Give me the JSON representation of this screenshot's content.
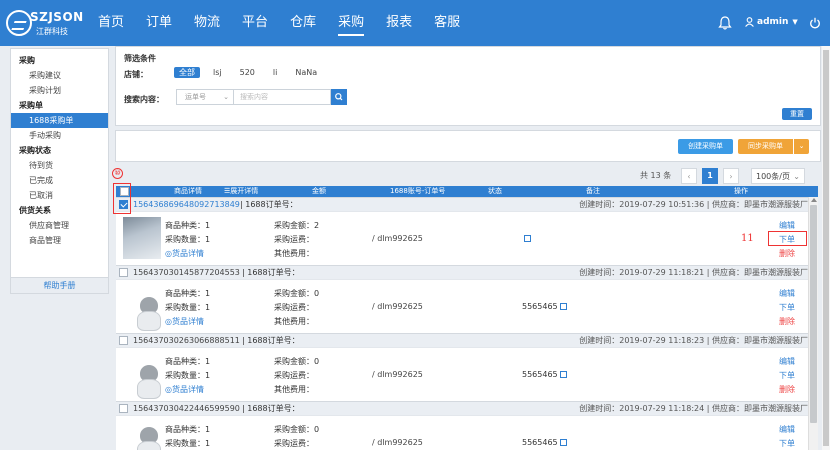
{
  "logo": {
    "name": "SZJSON",
    "sub": "江群科技"
  },
  "nav": [
    "首页",
    "订单",
    "物流",
    "平台",
    "仓库",
    "采购",
    "报表",
    "客服"
  ],
  "nav_active": 5,
  "user": {
    "name": "admin",
    "caret": "▼"
  },
  "sidebar": {
    "groups": [
      {
        "title": "采购",
        "items": [
          "采购建议",
          "采购计划"
        ]
      },
      {
        "title": "采购单",
        "items": [
          "1688采购单",
          "手动采购"
        ]
      },
      {
        "title": "采购状态",
        "items": [
          "待到货",
          "已完成",
          "已取消"
        ]
      },
      {
        "title": "供货关系",
        "items": [
          "供应商管理",
          "商品管理"
        ]
      }
    ],
    "active": "1688采购单",
    "help": "帮助手册"
  },
  "filter": {
    "title": "筛选条件",
    "shop_label": "店铺：",
    "shop_options": [
      "全部",
      "lsj",
      "520",
      "li",
      "NaNa"
    ],
    "search_label": "搜索内容：",
    "select_value": "运单号",
    "input_placeholder": "搜索内容",
    "reset": "重置"
  },
  "toolbar": {
    "create": "创建采购单",
    "sync": "同步采购单"
  },
  "pager": {
    "total": "共 13 条",
    "prev": "‹",
    "current": "1",
    "next": "›",
    "size": "100条/页"
  },
  "table": {
    "headers": {
      "detail": "商品详情",
      "expand": "☰展开详情",
      "amount": "金额",
      "account": "1688账号-订单号",
      "status": "状态",
      "remark": "备注",
      "op": "操作"
    },
    "labels": {
      "kinds": "商品种类：",
      "qty": "采购数量：",
      "detail_link": "◎货品详情",
      "amount": "采购金额：",
      "freight": "采购运费：",
      "other": "其他费用：",
      "order_no": "| 1688订单号：",
      "edit": "编辑",
      "place": "下单",
      "delete": "删除"
    },
    "orders": [
      {
        "no": "15643686964809271​3849",
        "created": "创建时间：2019-07-29 10:51:36  |  供应商：即墨市潮源服装厂",
        "kinds": "1",
        "qty": "1",
        "amount": "2",
        "account": "/ dlm992625",
        "remark": ""
      },
      {
        "no": "156437030145877204553",
        "created": "创建时间：2019-07-29 11:18:21  |  供应商：即墨市潮源服装厂",
        "kinds": "1",
        "qty": "1",
        "amount": "0",
        "account": "/ dlm992625",
        "remark": "5565465"
      },
      {
        "no": "156437030263066888511",
        "created": "创建时间：2019-07-29 11:18:23  |  供应商：即墨市潮源服装厂",
        "kinds": "1",
        "qty": "1",
        "amount": "0",
        "account": "/ dlm992625",
        "remark": "5565465"
      },
      {
        "no": "156437030422446599590",
        "created": "创建时间：2019-07-29 11:18:24  |  供应商：即墨市潮源服装厂",
        "kinds": "1",
        "qty": "1",
        "amount": "0",
        "account": "/ dlm992625",
        "remark": "5565465"
      }
    ]
  },
  "annotations": {
    "circle": "⑩",
    "num": "11"
  },
  "colors": {
    "primary": "#2f7fd1",
    "orange": "#f0a438",
    "danger": "#e44",
    "annotation": "#e33"
  }
}
